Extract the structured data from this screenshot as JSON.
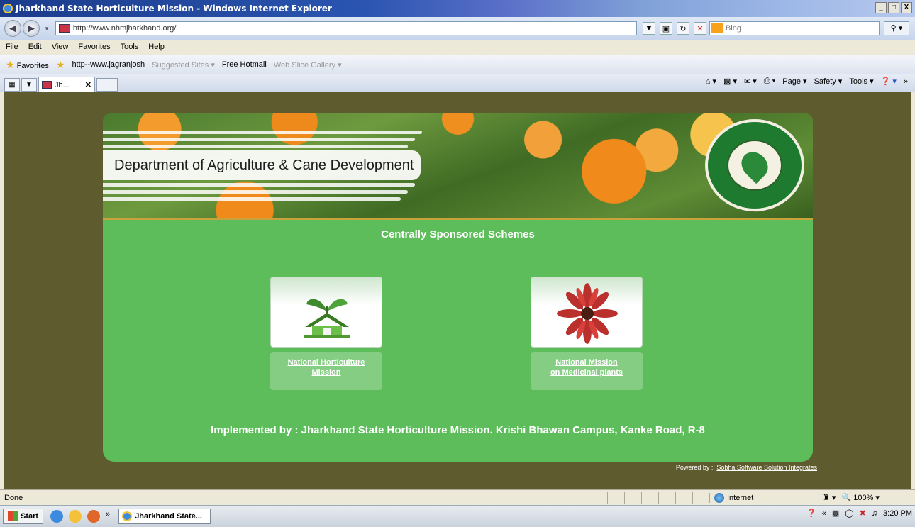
{
  "window": {
    "title": "Jharkhand State Horticulture Mission - Windows Internet Explorer",
    "min": "_",
    "max": "□",
    "close": "X"
  },
  "address": {
    "url": "http://www.nhmjharkhand.org/",
    "search_placeholder": "Bing"
  },
  "menu": [
    "File",
    "Edit",
    "View",
    "Favorites",
    "Tools",
    "Help"
  ],
  "favorites": {
    "label": "Favorites",
    "items": [
      "http--www.jagranjosh",
      "Suggested Sites ▾",
      "Free Hotmail",
      "Web Slice Gallery ▾"
    ]
  },
  "tab": {
    "label": "Jh..."
  },
  "commands": [
    "Page ▾",
    "Safety ▾",
    "Tools ▾"
  ],
  "page": {
    "banner_text": "Department of Agriculture & Cane Development",
    "heading": "Centrally Sponsored Schemes",
    "cards": [
      {
        "line1": "National Horticulture",
        "line2": "Mission"
      },
      {
        "line1": "National Mission",
        "line2": "on Medicinal plants"
      }
    ],
    "implemented": "Implemented by : Jharkhand State Horticulture Mission. Krishi Bhawan Campus, Kanke Road, R-8",
    "powered_prefix": "Powered by :: ",
    "powered_link": "Sobha Software Solution Integrates"
  },
  "status": {
    "text": "Done",
    "zone": "Internet",
    "zoom": "100%"
  },
  "taskbar": {
    "start": "Start",
    "item": "Jharkhand State...",
    "clock": "3:20 PM"
  },
  "colors": {
    "page_bg": "#5e5b2e",
    "panel_green": "#5ebd5b",
    "titlebar": "#1c3c8c"
  }
}
